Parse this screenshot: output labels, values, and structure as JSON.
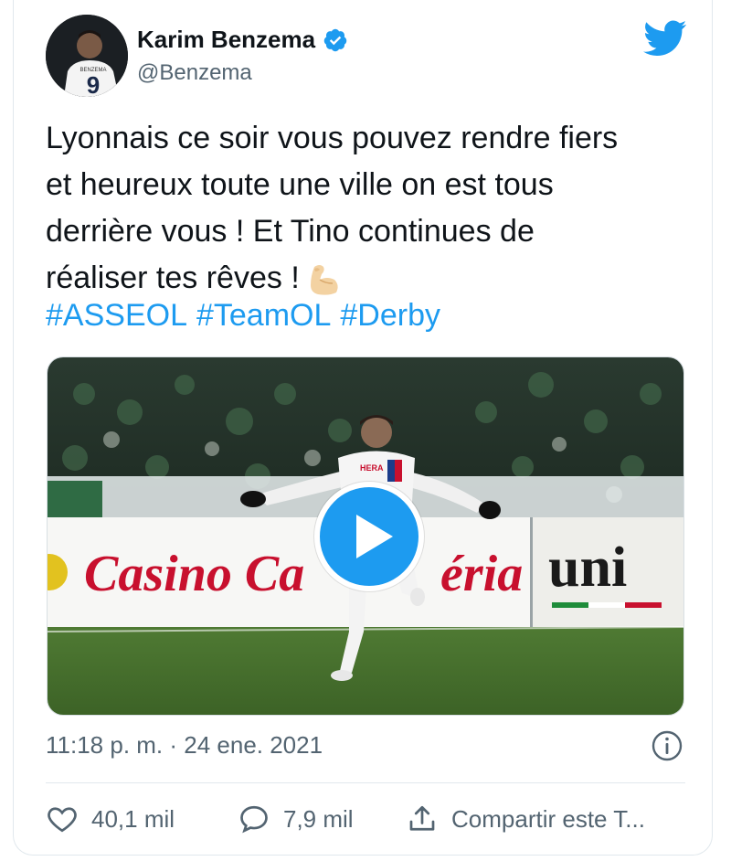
{
  "author": {
    "name": "Karim Benzema",
    "handle": "@Benzema",
    "avatar_text": "BENZEMA"
  },
  "tweet": {
    "text_lines": [
      "Lyonnais ce soir vous pouvez rendre fiers",
      "et heureux toute une ville on est tous",
      "derrière vous ! Et Tino continues de",
      "réaliser tes rêves !"
    ],
    "hashtags": [
      "#ASSEOL",
      "#TeamOL",
      "#Derby"
    ],
    "emoji": "flexed-biceps-icon"
  },
  "media": {
    "banner_left": "Casino Ca",
    "banner_mid": "éria",
    "banner_right": "uni",
    "shirt_text": "HERA"
  },
  "meta": {
    "timestamp": "11:18 p. m. · 24 ene. 2021"
  },
  "actions": {
    "likes": "40,1 mil",
    "replies": "7,9 mil",
    "share": "Compartir este T..."
  },
  "colors": {
    "accent": "#1d9bf0",
    "text": "#0f1419",
    "muted": "#536471"
  }
}
